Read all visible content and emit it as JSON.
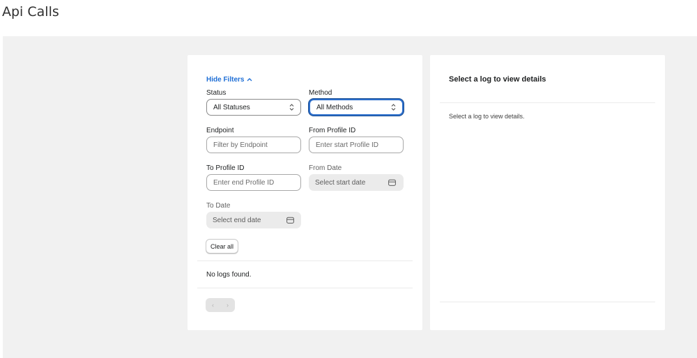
{
  "page": {
    "title": "Api Calls"
  },
  "filters": {
    "toggle_label": "Hide Filters",
    "status": {
      "label": "Status",
      "value": "All Statuses"
    },
    "method": {
      "label": "Method",
      "value": "All Methods"
    },
    "endpoint": {
      "label": "Endpoint",
      "placeholder": "Filter by Endpoint"
    },
    "from_profile": {
      "label": "From Profile ID",
      "placeholder": "Enter start Profile ID"
    },
    "to_profile": {
      "label": "To Profile ID",
      "placeholder": "Enter end Profile ID"
    },
    "from_date": {
      "label": "From Date",
      "placeholder": "Select start date"
    },
    "to_date": {
      "label": "To Date",
      "placeholder": "Select end date"
    },
    "clear_label": "Clear all"
  },
  "logs": {
    "empty_text": "No logs found.",
    "pager": {
      "prev": "‹",
      "next": "›"
    }
  },
  "details": {
    "title": "Select a log to view details",
    "body": "Select a log to view details."
  },
  "colors": {
    "link": "#1f6fd6",
    "focus_border": "#2c6ecb",
    "canvas_bg": "#f1f1f1"
  }
}
